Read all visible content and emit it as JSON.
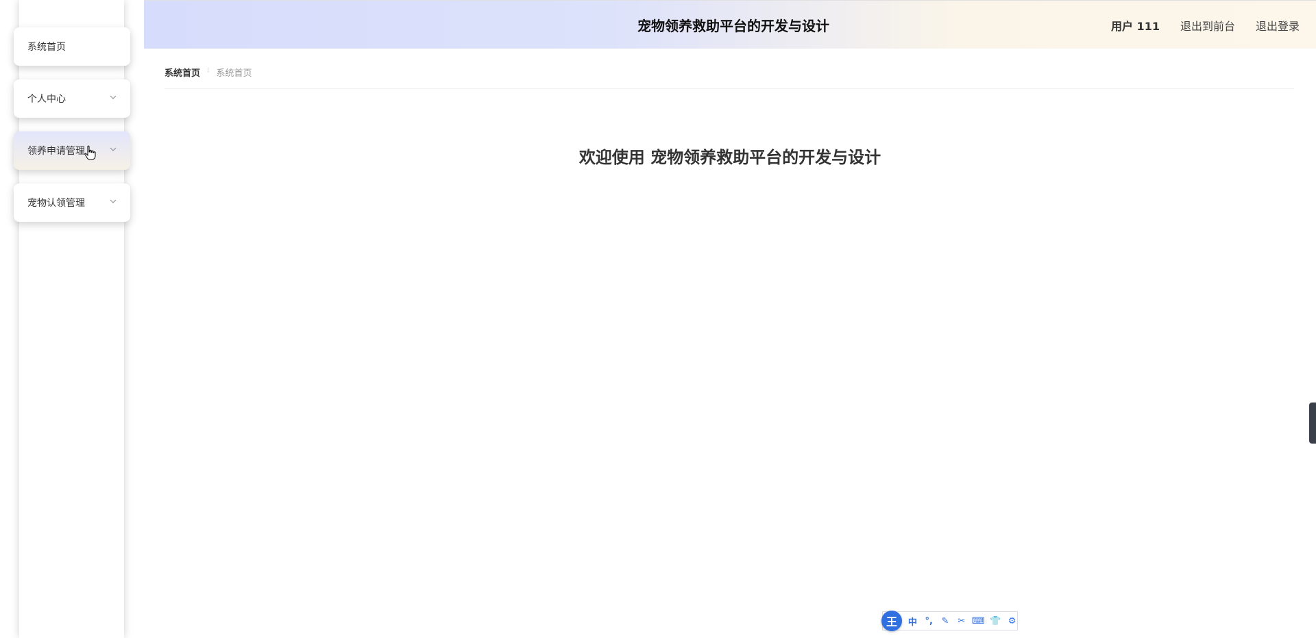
{
  "header": {
    "title": "宠物领养救助平台的开发与设计",
    "user": "用户 111",
    "to_front": "退出到前台",
    "logout": "退出登录"
  },
  "sidebar": {
    "items": [
      {
        "label": "系统首页",
        "has_submenu": false,
        "active": false
      },
      {
        "label": "个人中心",
        "has_submenu": true,
        "active": false
      },
      {
        "label": "领养申请管理",
        "has_submenu": true,
        "active": true
      },
      {
        "label": "宠物认领管理",
        "has_submenu": true,
        "active": false
      }
    ]
  },
  "breadcrumb": {
    "root": "系统首页",
    "separator": "⁝",
    "current": "系统首页"
  },
  "main": {
    "welcome": "欢迎使用 宠物领养救助平台的开发与设计"
  },
  "ime": {
    "logo": "王",
    "buttons": [
      "中",
      "°,",
      "✎",
      "✂",
      "⌨",
      "👕",
      "⚙"
    ]
  },
  "colors": {
    "header_gradient_start": "#d6dcfb",
    "header_gradient_end": "#fcf6eb",
    "active_item_top": "#e2e5fb",
    "active_item_bottom": "#f6f1e6",
    "ime_blue": "#2f6fe0"
  }
}
